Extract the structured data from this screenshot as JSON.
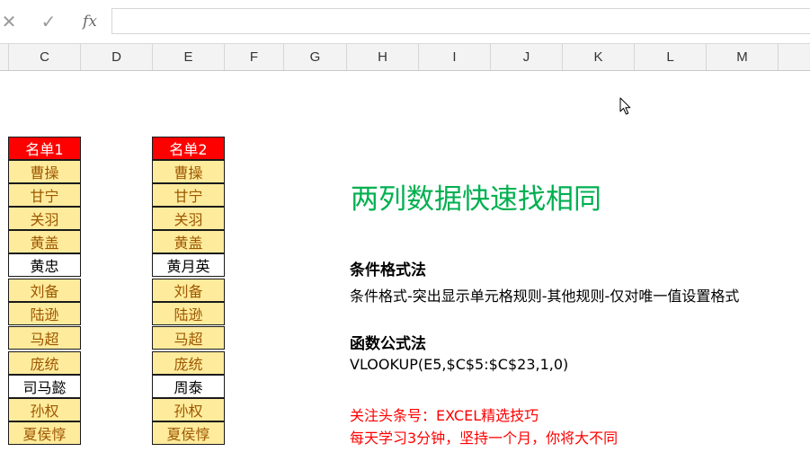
{
  "formula_bar": {
    "cancel_icon": "✕",
    "confirm_icon": "✓",
    "fx_label": "fx",
    "value": ""
  },
  "columns": [
    "C",
    "D",
    "E",
    "F",
    "G",
    "H",
    "I",
    "J",
    "K",
    "L",
    "M"
  ],
  "list1": {
    "header": "名单1",
    "items": [
      {
        "name": "曹操",
        "dup": true
      },
      {
        "name": "甘宁",
        "dup": true
      },
      {
        "name": "关羽",
        "dup": true
      },
      {
        "name": "黄盖",
        "dup": true
      },
      {
        "name": "黄忠",
        "dup": false
      },
      {
        "name": "刘备",
        "dup": true
      },
      {
        "name": "陆逊",
        "dup": true
      },
      {
        "name": "马超",
        "dup": true
      },
      {
        "name": "庞统",
        "dup": true
      },
      {
        "name": "司马懿",
        "dup": false
      },
      {
        "name": "孙权",
        "dup": true
      },
      {
        "name": "夏侯惇",
        "dup": true
      }
    ]
  },
  "list2": {
    "header": "名单2",
    "items": [
      {
        "name": "曹操",
        "dup": true
      },
      {
        "name": "甘宁",
        "dup": true
      },
      {
        "name": "关羽",
        "dup": true
      },
      {
        "name": "黄盖",
        "dup": true
      },
      {
        "name": "黄月英",
        "dup": false
      },
      {
        "name": "刘备",
        "dup": true
      },
      {
        "name": "陆逊",
        "dup": true
      },
      {
        "name": "马超",
        "dup": true
      },
      {
        "name": "庞统",
        "dup": true
      },
      {
        "name": "周泰",
        "dup": false
      },
      {
        "name": "孙权",
        "dup": true
      },
      {
        "name": "夏侯惇",
        "dup": true
      }
    ]
  },
  "notes": {
    "title": "两列数据快速找相同",
    "method1_heading": "条件格式法",
    "method1_body": "条件格式-突出显示单元格规则-其他规则-仅对唯一值设置格式",
    "method2_heading": "函数公式法",
    "method2_body": "VLOOKUP(E5,$C$5:$C$23,1,0)",
    "promo_line1": "关注头条号：EXCEL精选技巧",
    "promo_line2": "每天学习3分钟，坚持一个月，你将大不同"
  },
  "colors": {
    "header_fill": "#ff0000",
    "duplicate_fill": "#ffeb9c",
    "duplicate_text": "#9c5700",
    "title_green": "#00b050",
    "promo_red": "#ff0000"
  }
}
